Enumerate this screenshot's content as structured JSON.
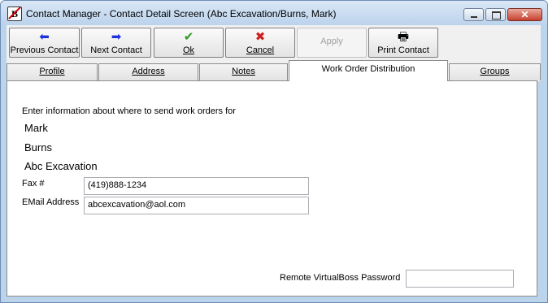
{
  "window": {
    "title": "Contact Manager - Contact Detail Screen (Abc Excavation/Burns, Mark)",
    "app_icon_letter": "B",
    "close_glyph": "✕"
  },
  "toolbar": {
    "buttons": [
      {
        "label": "Previous Contact",
        "icon": "left-arrow-icon",
        "glyph": "⬅",
        "color": "#1e32d8",
        "enabled": true
      },
      {
        "label": "Next Contact",
        "icon": "right-arrow-icon",
        "glyph": "➡",
        "color": "#1e32d8",
        "enabled": true
      },
      {
        "label": "Ok",
        "icon": "checkmark-icon",
        "glyph": "✔",
        "color": "#2f9a21",
        "enabled": true
      },
      {
        "label": "Cancel",
        "icon": "x-icon",
        "glyph": "✖",
        "color": "#d01d1d",
        "enabled": true
      },
      {
        "label": "Apply",
        "icon": "",
        "glyph": "",
        "color": "#a0a0a0",
        "enabled": false
      },
      {
        "label": "Print Contact",
        "icon": "printer-icon",
        "glyph": "🖶",
        "color": "#000000",
        "enabled": true
      }
    ]
  },
  "tabs": [
    {
      "label": "Profile",
      "active": false
    },
    {
      "label": "Address",
      "active": false
    },
    {
      "label": "Notes",
      "active": false
    },
    {
      "label": "Work Order Distribution",
      "active": true
    },
    {
      "label": "Groups",
      "active": false
    }
  ],
  "panel": {
    "intro": "Enter information about where to send work orders for",
    "first_name": "Mark",
    "last_name": "Burns",
    "company": "Abc Excavation",
    "fax_label": "Fax #",
    "fax_value": "(419)888-1234",
    "email_label": "EMail Address",
    "email_value": "abcexcavation@aol.com",
    "remote_password_label": "Remote VirtualBoss Password",
    "remote_password_value": ""
  }
}
